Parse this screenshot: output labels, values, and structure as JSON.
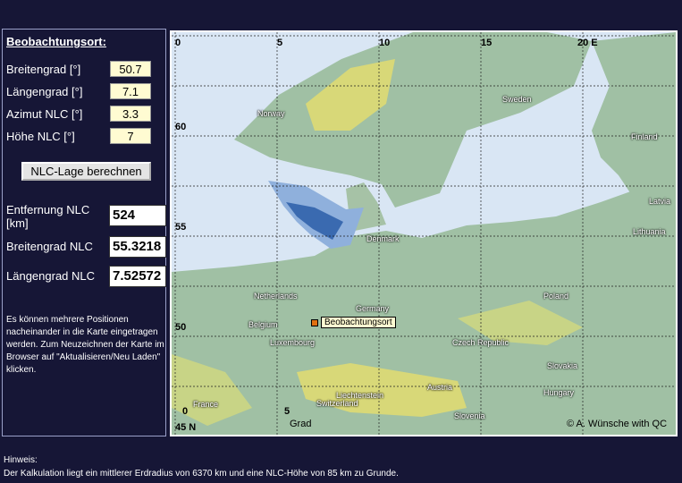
{
  "panel": {
    "heading": "Beobachtungsort:",
    "inputs": [
      {
        "label": "Breitengrad [°]",
        "value": "50.7"
      },
      {
        "label": "Längengrad [°]",
        "value": "7.1"
      },
      {
        "label": "Azimut NLC [°]",
        "value": "3.3"
      },
      {
        "label": "Höhe NLC [°]",
        "value": "7"
      }
    ],
    "button_label": "NLC-Lage berechnen",
    "outputs": [
      {
        "label": "Entfernung NLC [km]",
        "value": "524"
      },
      {
        "label": "Breitengrad NLC",
        "value": "55.3218"
      },
      {
        "label": "Längengrad NLC",
        "value": "7.52572"
      }
    ],
    "note": "Es können mehrere Positionen nacheinander in die Karte eingetragen werden. Zum Neuzeichnen der Karte im Browser auf \"Aktualisieren/Neu Laden\" klicken."
  },
  "map": {
    "lon_ticks": [
      "0",
      "5",
      "10",
      "15",
      "20 E"
    ],
    "lat_ticks": [
      "60",
      "55",
      "50",
      "45 N"
    ],
    "countries": [
      "Norway",
      "Sweden",
      "Finland",
      "Latvia",
      "Lithuania",
      "Denmark",
      "Netherlands",
      "Germany",
      "Poland",
      "Belgium",
      "Luxembourg",
      "Czech Republic",
      "Slovakia",
      "Austria",
      "Hungary",
      "Liechtenstein",
      "Switzerland",
      "Slovenia",
      "France"
    ],
    "bottom_ticks": [
      "0",
      "5"
    ],
    "grad_label": "Grad",
    "marker_label": "Beobachtungsort",
    "credit": "© A. Wünsche with QC"
  },
  "footer": {
    "line1": "Hinweis:",
    "line2": "Der Kalkulation liegt ein mittlerer Erdradius von 6370 km und eine NLC-Höhe von 85 km zu Grunde."
  },
  "colors": {
    "background": "#161636",
    "input_bg": "#fffbd2",
    "sea": "#d9e6f4",
    "land": "#a0c0a4",
    "highland": "#d8d878",
    "nlc": "#3a6ab0"
  }
}
